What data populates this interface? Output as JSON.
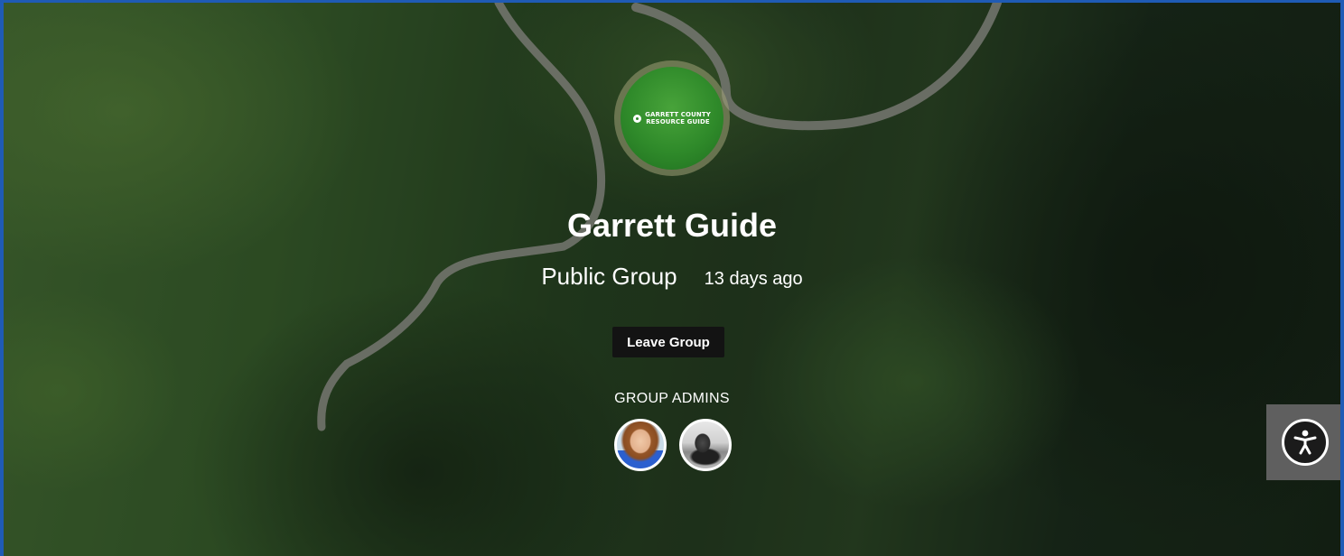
{
  "group": {
    "logo_text_line1": "GARRETT COUNTY",
    "logo_text_line2": "RESOURCE GUIDE",
    "title": "Garrett Guide",
    "type": "Public Group",
    "last_active": "13 days ago"
  },
  "actions": {
    "leave_label": "Leave Group"
  },
  "admins": {
    "label": "GROUP ADMINS",
    "count": 2
  },
  "accessibility": {
    "icon": "accessibility-icon"
  },
  "colors": {
    "top_border": "#1f5bb5",
    "button_bg": "#131313",
    "logo_green": "#2f8a2a",
    "a11y_bg": "#5f5f5f"
  }
}
